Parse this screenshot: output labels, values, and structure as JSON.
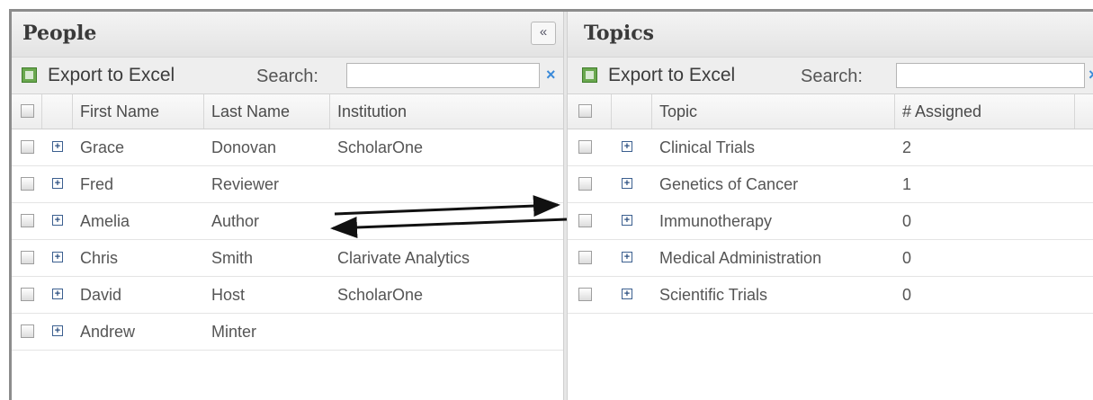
{
  "people": {
    "title": "People",
    "collapse_label": "«",
    "export_label": "Export to Excel",
    "search_label": "Search:",
    "search_value": "",
    "search_clear": "×",
    "columns": [
      "First Name",
      "Last Name",
      "Institution"
    ],
    "rows": [
      {
        "first": "Grace",
        "last": "Donovan",
        "institution": "ScholarOne"
      },
      {
        "first": "Fred",
        "last": "Reviewer",
        "institution": ""
      },
      {
        "first": "Amelia",
        "last": "Author",
        "institution": ""
      },
      {
        "first": "Chris",
        "last": "Smith",
        "institution": "Clarivate Analytics"
      },
      {
        "first": "David",
        "last": "Host",
        "institution": "ScholarOne"
      },
      {
        "first": "Andrew",
        "last": "Minter",
        "institution": ""
      }
    ]
  },
  "topics": {
    "title": "Topics",
    "export_label": "Export to Excel",
    "search_label": "Search:",
    "search_value": "",
    "search_clear": "×",
    "columns": [
      "Topic",
      "# Assigned"
    ],
    "rows": [
      {
        "topic": "Clinical Trials",
        "assigned": "2"
      },
      {
        "topic": "Genetics of Cancer",
        "assigned": "1"
      },
      {
        "topic": "Immunotherapy",
        "assigned": "0"
      },
      {
        "topic": "Medical Administration",
        "assigned": "0"
      },
      {
        "topic": "Scientific Trials",
        "assigned": "0"
      }
    ]
  },
  "icons": {
    "excel": "excel-icon",
    "expand": "plus-box-icon",
    "checkbox": "checkbox-icon",
    "collapse": "double-chevron-left-icon",
    "clear": "close-icon"
  },
  "colors": {
    "clear_icon": "#3b8ad9",
    "excel_icon": "#6aa84f",
    "expand_icon": "#2b4f80"
  }
}
